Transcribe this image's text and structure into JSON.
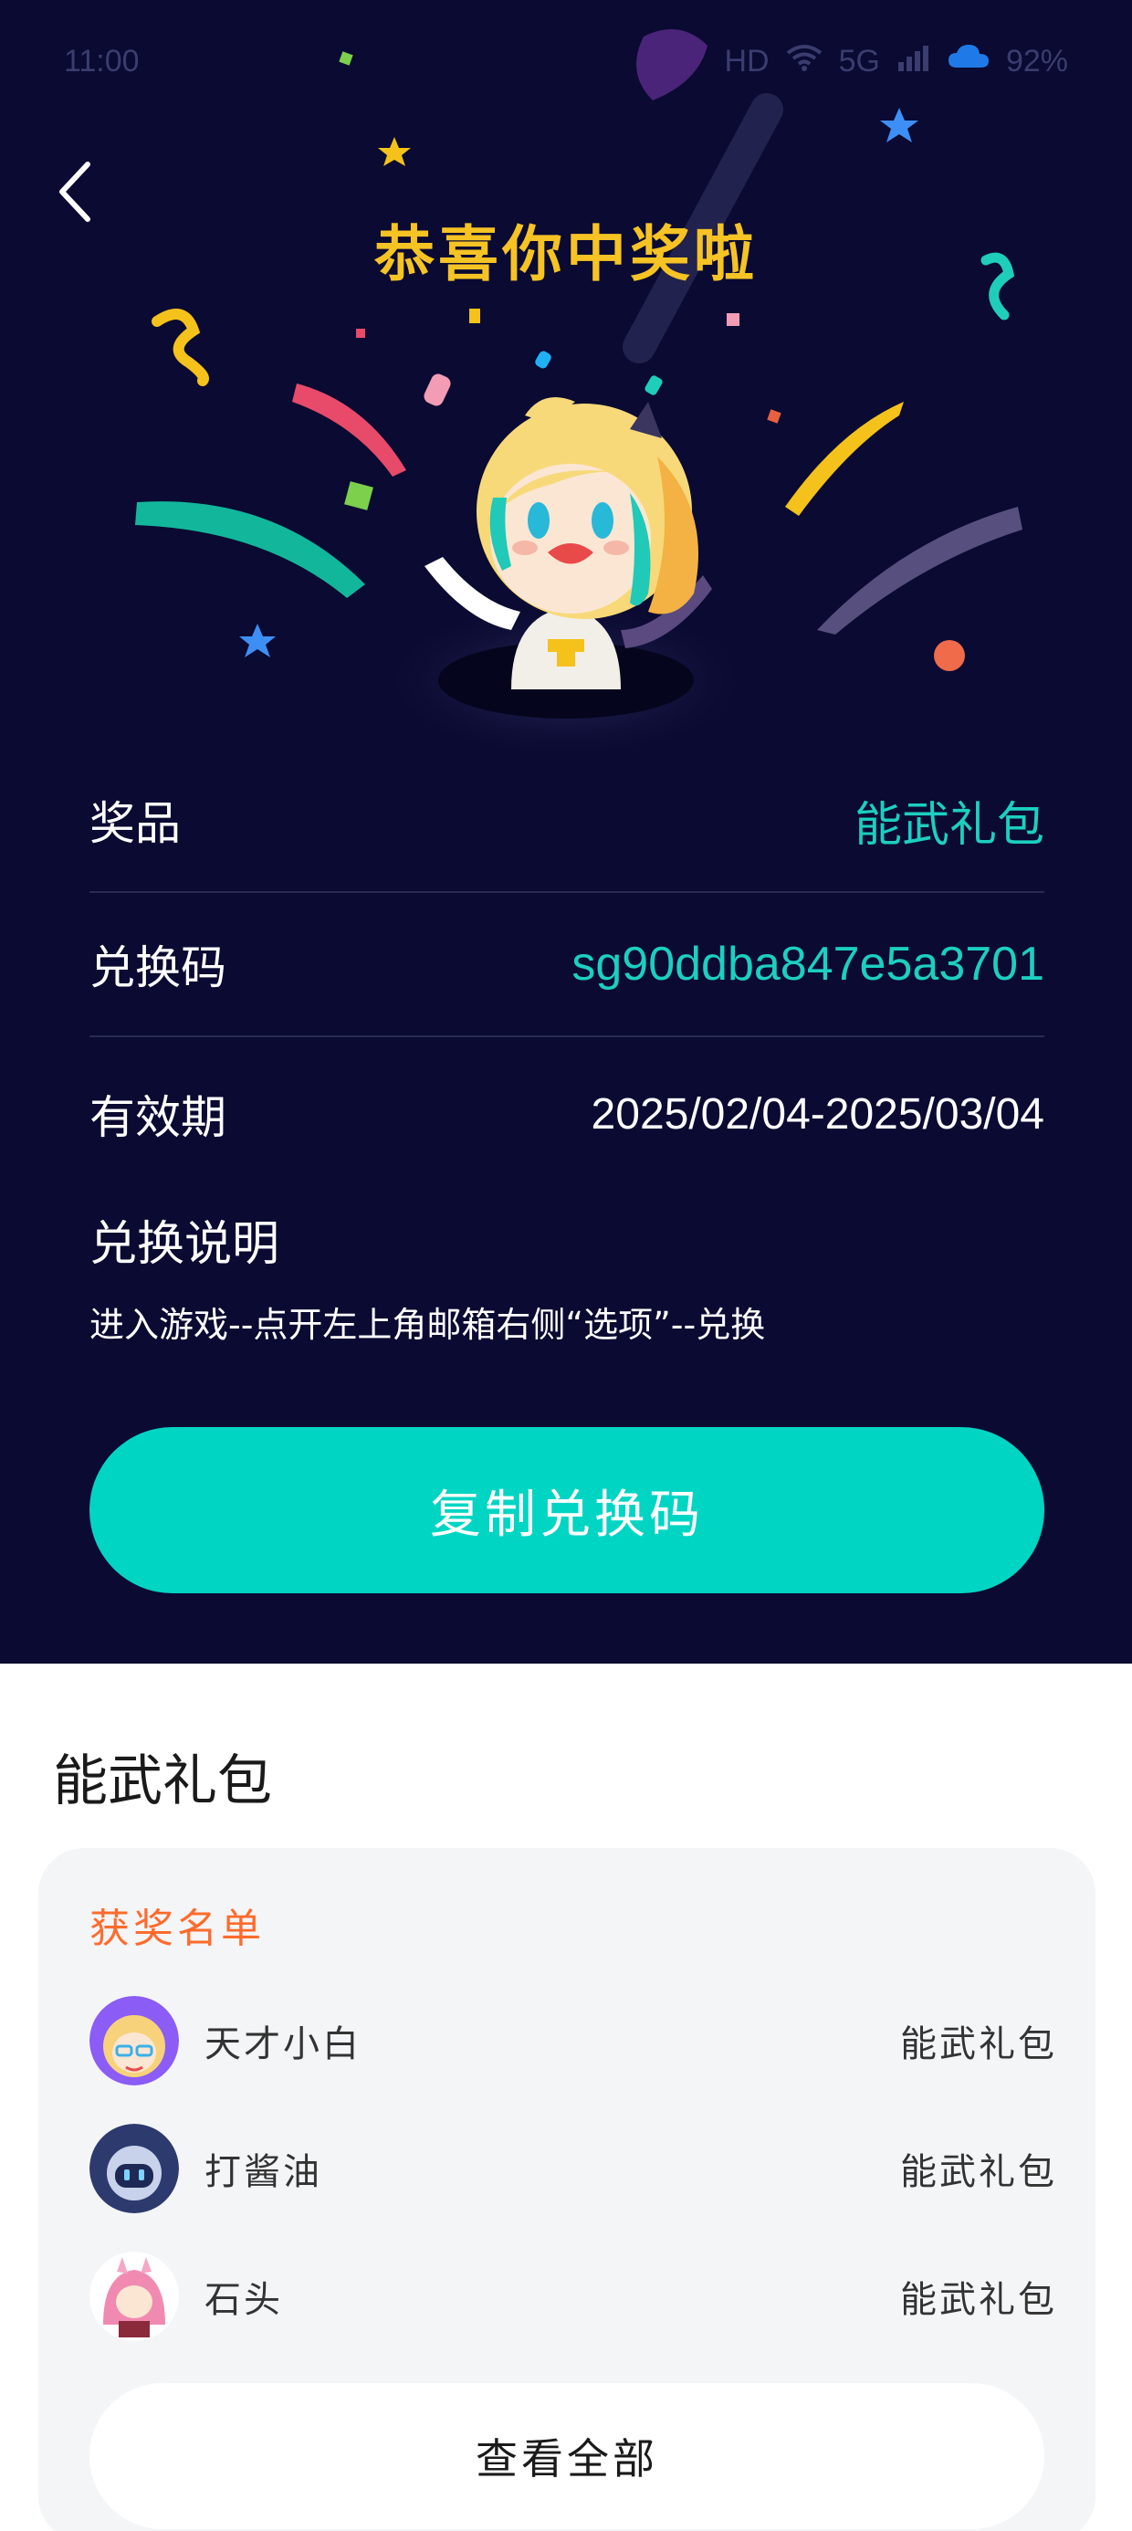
{
  "status_bar": {
    "time": "11:00",
    "network": "HD",
    "signal": "5G",
    "battery": "92%"
  },
  "header": {
    "title": "恭喜你中奖啦"
  },
  "prize_info": {
    "prize_label": "奖品",
    "prize_value": "能武礼包",
    "code_label": "兑换码",
    "code_value": "sg90ddba847e5a3701",
    "validity_label": "有效期",
    "validity_value": "2025/02/04-2025/03/04",
    "instructions_title": "兑换说明",
    "instructions_text": "进入游戏--点开左上角邮箱右侧“选项”--兑换"
  },
  "copy_button": {
    "label": "复制兑换码"
  },
  "gift_section": {
    "title": "能武礼包",
    "winners_title": "获奖名单",
    "winners": [
      {
        "name": "天才小白",
        "prize": "能武礼包",
        "avatar": "blonde-girl-avatar"
      },
      {
        "name": "打酱油",
        "prize": "能武礼包",
        "avatar": "robot-avatar"
      },
      {
        "name": "石头",
        "prize": "能武礼包",
        "avatar": "pink-hair-avatar"
      }
    ],
    "view_all_label": "查看全部"
  },
  "colors": {
    "background_dark": "#0a0a32",
    "accent_teal": "#00d5c3",
    "title_gold": "#f6c324",
    "winners_title_orange": "#ff6b2c"
  }
}
